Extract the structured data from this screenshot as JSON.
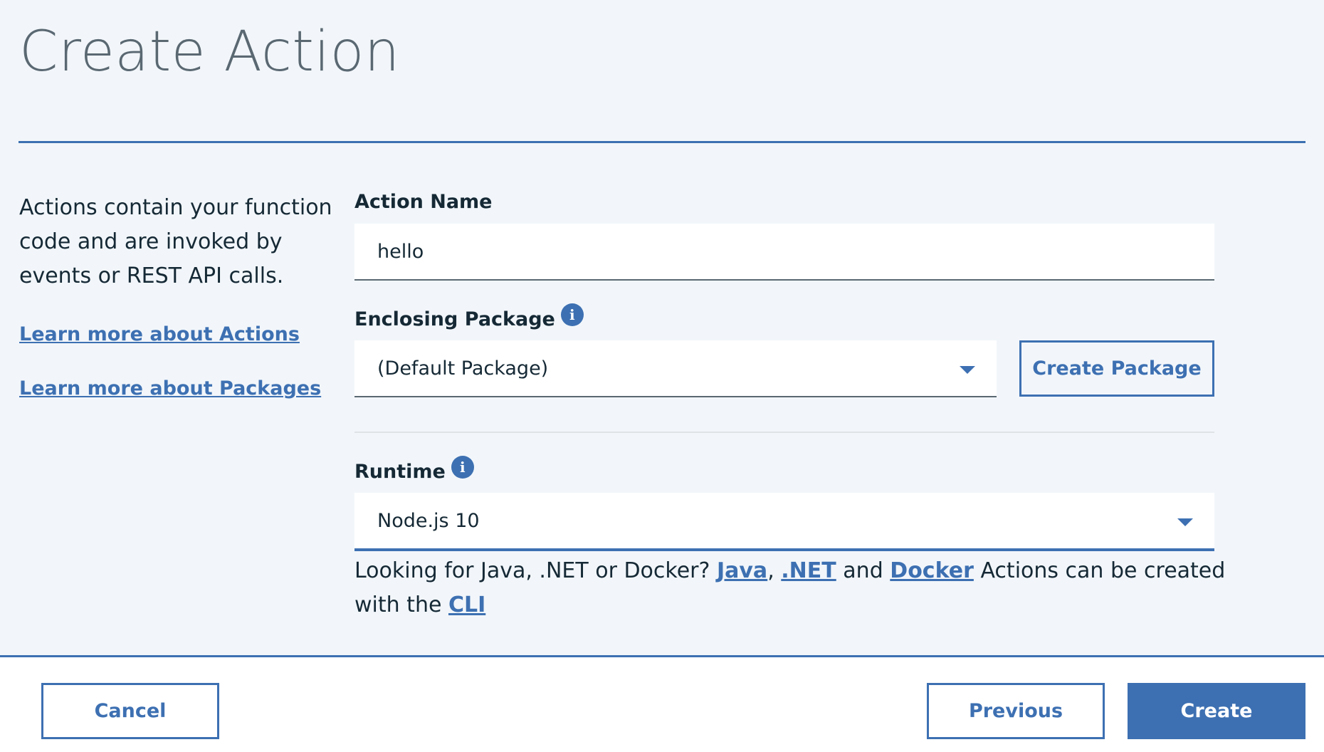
{
  "page": {
    "title": "Create Action"
  },
  "sidebar": {
    "description": "Actions contain your function code and are invoked by events or REST API calls.",
    "links": {
      "actions": "Learn more about Actions",
      "packages": "Learn more about Packages"
    }
  },
  "form": {
    "action_name": {
      "label": "Action Name",
      "value": "hello"
    },
    "enclosing_package": {
      "label": "Enclosing Package",
      "selected": "(Default Package)",
      "create_button": "Create Package"
    },
    "runtime": {
      "label": "Runtime",
      "selected": "Node.js 10"
    },
    "hint": {
      "prefix": "Looking for Java, .NET or Docker?",
      "java": "Java",
      "comma": ",",
      "dotnet": ".NET",
      "and": "and",
      "docker": "Docker",
      "middle": "Actions can be created with the",
      "cli": "CLI"
    }
  },
  "footer": {
    "cancel": "Cancel",
    "previous": "Previous",
    "create": "Create"
  },
  "colors": {
    "accent": "#3d70b2",
    "background": "#f2f6fa",
    "title": "#5a6872",
    "text": "#152935"
  },
  "icons": {
    "info": "info-circle-icon",
    "dropdown": "caret-down-icon"
  }
}
